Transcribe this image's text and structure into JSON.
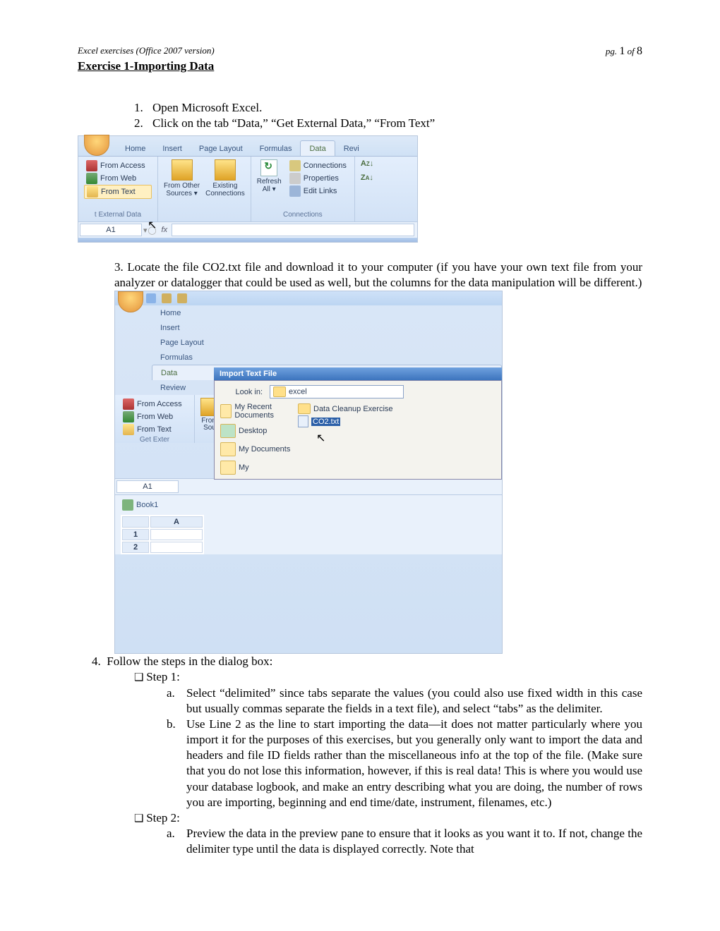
{
  "header": {
    "left": "Excel exercises (Office 2007 version)",
    "pg_label": "pg.",
    "pg_num": "1",
    "of_label": "of",
    "pg_total": "8"
  },
  "title": "Exercise 1-Importing Data",
  "steps": {
    "s1": "Open Microsoft Excel.",
    "s2": "Click on the tab “Data,” “Get External Data,” “From Text”",
    "s3": "3.   Locate the file CO2.txt file and download it to your computer (if you have your own text file from your analyzer or datalogger that could be used as well, but the columns for the data manipulation will be different.)",
    "s4": "Follow the steps in the dialog box:"
  },
  "ribbon": {
    "tabs": {
      "home": "Home",
      "insert": "Insert",
      "pagelayout": "Page Layout",
      "formulas": "Formulas",
      "data": "Data",
      "review": "Revi",
      "review_full": "Review"
    },
    "from_access": "From Access",
    "from_web": "From Web",
    "from_text": "From Text",
    "from_other": "From Other Sources",
    "existing": "Existing Connections",
    "refresh": "Refresh All",
    "connections": "Connections",
    "properties": "Properties",
    "editlinks": "Edit Links",
    "group_ext": "t External Data",
    "group_ext2": "Get Exter",
    "group_conn": "Connections",
    "cell": "A1",
    "fx": "fx",
    "from": "From Sou",
    "sort_az": "A↓Z",
    "sort_za": "Z↓A"
  },
  "dialog": {
    "title": "Import Text File",
    "lookin": "Look in:",
    "folder": "excel",
    "recent": "My Recent Documents",
    "desktop": "Desktop",
    "mydocs": "My Documents",
    "my": "My",
    "cleanup": "Data Cleanup Exercise",
    "co2": "CO2.txt",
    "book": "Book1",
    "colA": "A"
  },
  "step4": {
    "step1_label": "Step 1:",
    "a": "Select “delimited” since tabs separate the values (you could also use fixed width in this case but usually commas separate the fields in a text file), and select “tabs” as the delimiter.",
    "b": "Use Line 2 as the line to start importing the data—it does not matter particularly where you import it for the purposes of this exercises, but you generally only want to import the data and headers and file ID fields rather than the miscellaneous info at the top of the file.  (Make sure that you do not lose this information, however, if this is real data!  This is where you would use your database logbook, and make an entry describing what you are doing, the number of rows you are importing, beginning and end time/date, instrument, filenames, etc.)",
    "step2_label": "Step 2:",
    "s2a": "Preview the data in the preview pane to ensure that it looks as you want it to.  If not, change the delimiter type until the data is displayed correctly.  Note that"
  }
}
